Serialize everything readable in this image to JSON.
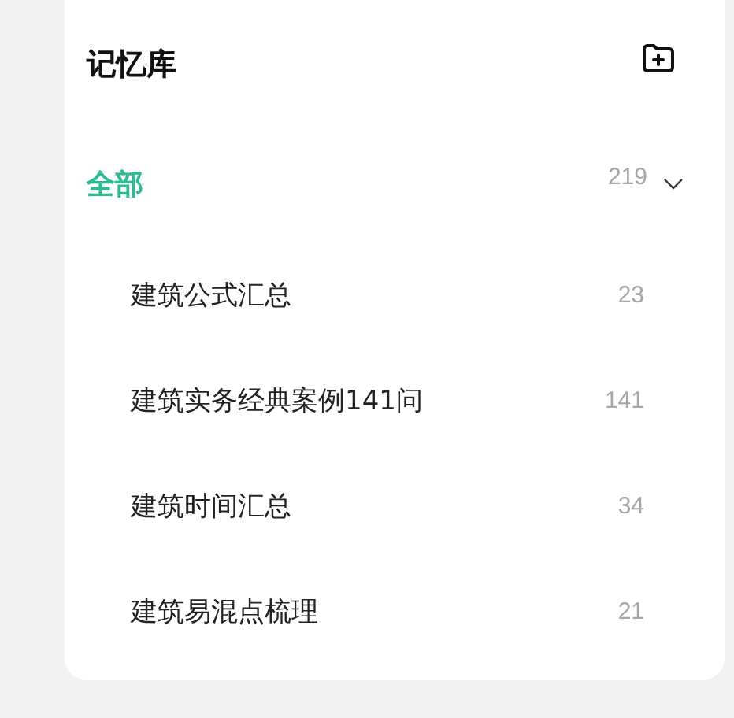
{
  "title": "记忆库",
  "category": {
    "label": "全部",
    "count": "219",
    "selected": true,
    "expanded": true,
    "children": [
      {
        "label": "建筑公式汇总",
        "count": "23",
        "selected": false
      },
      {
        "label": "建筑实务经典案例141问",
        "count": "141",
        "selected": false
      },
      {
        "label": "建筑时间汇总",
        "count": "34",
        "selected": false
      },
      {
        "label": "建筑易混点梳理",
        "count": "21",
        "selected": false
      }
    ]
  }
}
